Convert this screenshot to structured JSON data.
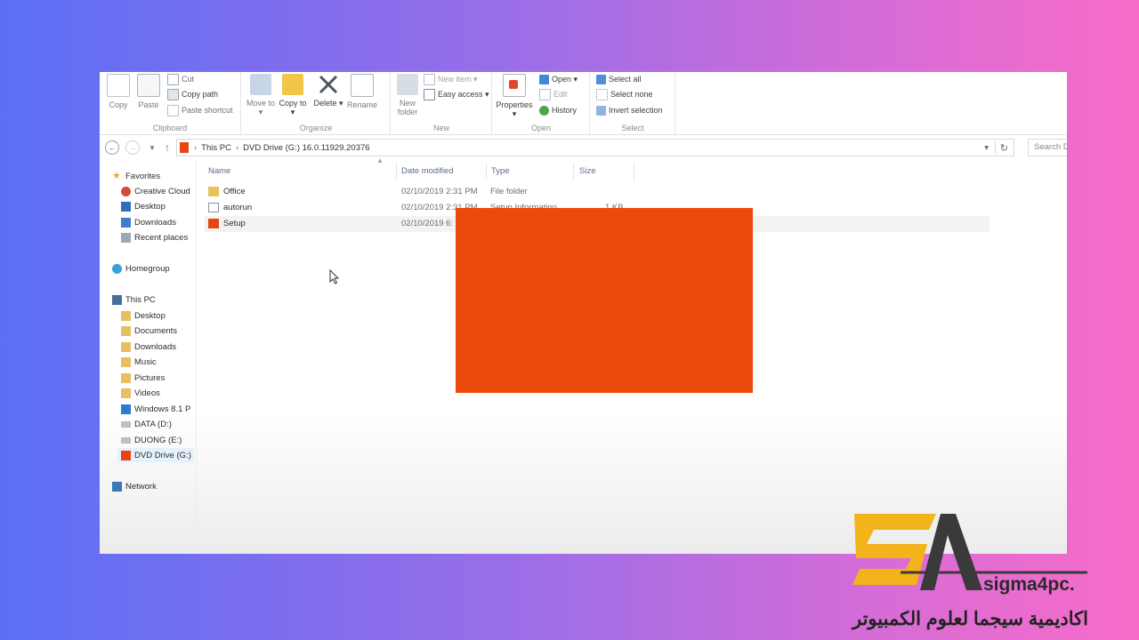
{
  "ribbon": {
    "clipboard": {
      "label": "Clipboard",
      "copy": "Copy",
      "paste": "Paste",
      "cut": "Cut",
      "copy_path": "Copy path",
      "paste_shortcut": "Paste shortcut"
    },
    "organize": {
      "label": "Organize",
      "move_to": "Move to ▾",
      "copy_to": "Copy to ▾",
      "delete": "Delete ▾",
      "rename": "Rename"
    },
    "new": {
      "label": "New",
      "new_folder": "New folder",
      "new_item": "New item ▾",
      "easy_access": "Easy access ▾"
    },
    "open": {
      "label": "Open",
      "properties": "Properties ▾",
      "open": "Open ▾",
      "edit": "Edit",
      "history": "History"
    },
    "select": {
      "label": "Select",
      "select_all": "Select all",
      "select_none": "Select none",
      "invert_selection": "Invert selection"
    }
  },
  "address": {
    "back": "←",
    "forward": "→",
    "recent": "▾",
    "up": "↑",
    "crumbs": [
      "This PC",
      "DVD Drive (G:) 16.0.11929.20376"
    ],
    "dropdown": "▾",
    "refresh": "↻",
    "search_placeholder": "Search D"
  },
  "nav": {
    "favorites": "Favorites",
    "favorites_items": [
      "Creative Cloud",
      "Desktop",
      "Downloads",
      "Recent places"
    ],
    "homegroup": "Homegroup",
    "this_pc": "This PC",
    "pc_items": [
      "Desktop",
      "Documents",
      "Downloads",
      "Music",
      "Pictures",
      "Videos",
      "Windows 8.1 P",
      "DATA (D:)",
      "DUONG (E:)",
      "DVD Drive (G:)"
    ],
    "network": "Network"
  },
  "columns": {
    "name": "Name",
    "date": "Date modified",
    "type": "Type",
    "size": "Size",
    "sort": "▲"
  },
  "files": [
    {
      "name": "Office",
      "date": "02/10/2019 2:31 PM",
      "type": "File folder",
      "size": ""
    },
    {
      "name": "autorun",
      "date": "02/10/2019 2:31 PM",
      "type": "Setup Information",
      "size": "1 KB"
    },
    {
      "name": "Setup",
      "date": "02/10/2019 6:",
      "type": "",
      "size": ""
    }
  ],
  "watermark": {
    "site": "sigma4pc.",
    "arabic": "اكاديمية سيجما لعلوم الكمبيوتر"
  },
  "colors": {
    "splash": "#ec4a0c",
    "logo_gold": "#f3b41b",
    "selection": "#e5f1fb"
  }
}
